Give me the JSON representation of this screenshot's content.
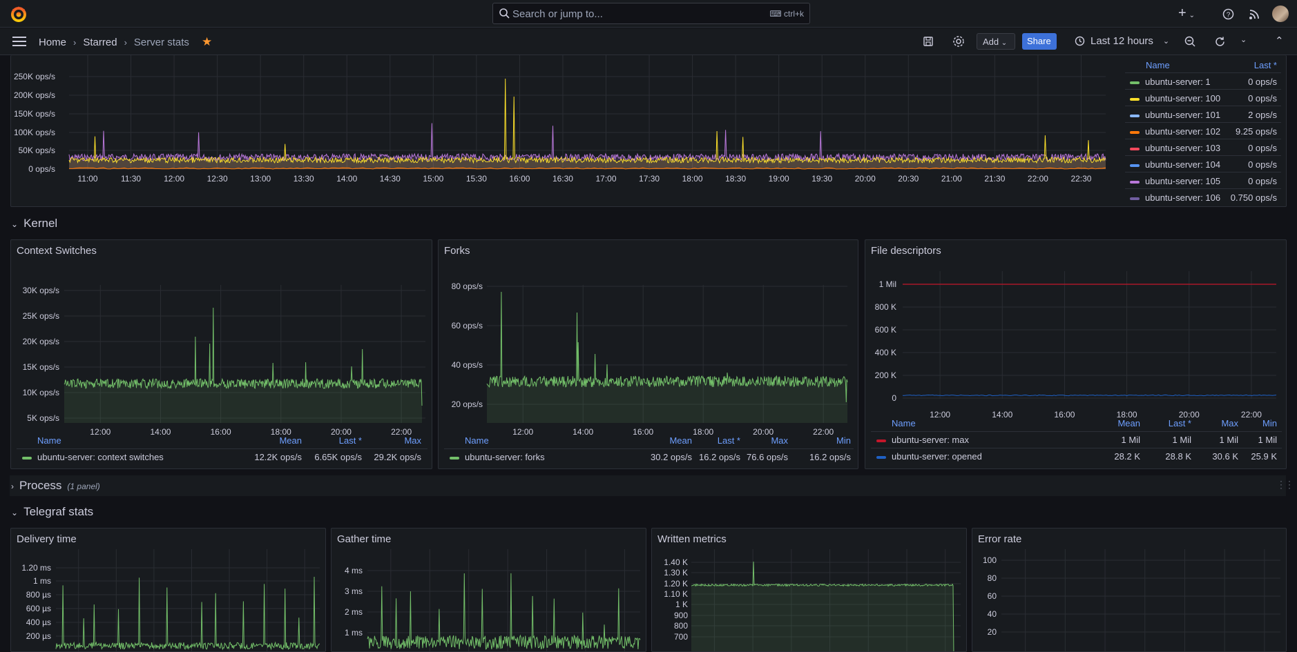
{
  "topbar": {
    "search_placeholder": "Search or jump to...",
    "search_shortcut": "ctrl+k",
    "add_icon": "+",
    "icons": [
      "help-icon",
      "news-icon"
    ]
  },
  "navbar": {
    "breadcrumbs": [
      "Home",
      "Starred",
      "Server stats"
    ],
    "add_label": "Add",
    "share_label": "Share",
    "time_range": "Last 12 hours"
  },
  "top_panel": {
    "y_ticks": [
      "250K ops/s",
      "200K ops/s",
      "150K ops/s",
      "100K ops/s",
      "50K ops/s",
      "0 ops/s"
    ],
    "x_ticks": [
      "11:00",
      "11:30",
      "12:00",
      "12:30",
      "13:00",
      "13:30",
      "14:00",
      "14:30",
      "15:00",
      "15:30",
      "16:00",
      "16:30",
      "17:00",
      "17:30",
      "18:00",
      "18:30",
      "19:00",
      "19:30",
      "20:00",
      "20:30",
      "21:00",
      "21:30",
      "22:00",
      "22:30"
    ],
    "legend_headers": [
      "Name",
      "Last *"
    ],
    "legend": [
      {
        "name": "ubuntu-server: 1",
        "last": "0 ops/s",
        "color": "#73bf69"
      },
      {
        "name": "ubuntu-server: 100",
        "last": "0 ops/s",
        "color": "#fade2a"
      },
      {
        "name": "ubuntu-server: 101",
        "last": "2 ops/s",
        "color": "#8ab8ff"
      },
      {
        "name": "ubuntu-server: 102",
        "last": "9.25 ops/s",
        "color": "#ff780a"
      },
      {
        "name": "ubuntu-server: 103",
        "last": "0 ops/s",
        "color": "#f2495c"
      },
      {
        "name": "ubuntu-server: 104",
        "last": "0 ops/s",
        "color": "#5794f2"
      },
      {
        "name": "ubuntu-server: 105",
        "last": "0 ops/s",
        "color": "#b877d9"
      },
      {
        "name": "ubuntu-server: 106",
        "last": "0.750 ops/s",
        "color": "#705da0"
      }
    ]
  },
  "rows": {
    "kernel": "Kernel",
    "process": "Process",
    "process_sub": "(1 panel)",
    "telegraf": "Telegraf stats"
  },
  "context_switches": {
    "title": "Context Switches",
    "y_ticks": [
      "30K ops/s",
      "25K ops/s",
      "20K ops/s",
      "15K ops/s",
      "10K ops/s",
      "5K ops/s"
    ],
    "x_ticks": [
      "12:00",
      "14:00",
      "16:00",
      "18:00",
      "20:00",
      "22:00"
    ],
    "headers": [
      "Name",
      "Mean",
      "Last *",
      "Max"
    ],
    "row": {
      "name": "ubuntu-server: context switches",
      "mean": "12.2K ops/s",
      "last": "6.65K ops/s",
      "max": "29.2K ops/s",
      "color": "#73bf69"
    }
  },
  "forks": {
    "title": "Forks",
    "y_ticks": [
      "80 ops/s",
      "60 ops/s",
      "40 ops/s",
      "20 ops/s"
    ],
    "x_ticks": [
      "12:00",
      "14:00",
      "16:00",
      "18:00",
      "20:00",
      "22:00"
    ],
    "headers": [
      "Name",
      "Mean",
      "Last *",
      "Max",
      "Min"
    ],
    "row": {
      "name": "ubuntu-server: forks",
      "mean": "30.2 ops/s",
      "last": "16.2 ops/s",
      "max": "76.6 ops/s",
      "min": "16.2 ops/s",
      "color": "#73bf69"
    }
  },
  "file_descriptors": {
    "title": "File descriptors",
    "y_ticks": [
      "1 Mil",
      "800 K",
      "600 K",
      "400 K",
      "200 K",
      "0"
    ],
    "x_ticks": [
      "12:00",
      "14:00",
      "16:00",
      "18:00",
      "20:00",
      "22:00"
    ],
    "headers": [
      "Name",
      "Mean",
      "Last *",
      "Max",
      "Min"
    ],
    "rows": [
      {
        "name": "ubuntu-server: max",
        "mean": "1 Mil",
        "last": "1 Mil",
        "max": "1 Mil",
        "min": "1 Mil",
        "color": "#c4162a"
      },
      {
        "name": "ubuntu-server: opened",
        "mean": "28.2 K",
        "last": "28.8 K",
        "max": "30.6 K",
        "min": "25.9 K",
        "color": "#1f60c4"
      }
    ]
  },
  "delivery_time": {
    "title": "Delivery time",
    "y_ticks": [
      "1.20 ms",
      "1 ms",
      "800 µs",
      "600 µs",
      "400 µs",
      "200 µs"
    ]
  },
  "gather_time": {
    "title": "Gather time",
    "y_ticks": [
      "4 ms",
      "3 ms",
      "2 ms",
      "1 ms"
    ]
  },
  "written_metrics": {
    "title": "Written metrics",
    "y_ticks": [
      "1.40 K",
      "1.30 K",
      "1.20 K",
      "1.10 K",
      "1 K",
      "900",
      "800",
      "700"
    ]
  },
  "error_rate": {
    "title": "Error rate",
    "y_ticks": [
      "100",
      "80",
      "60",
      "40",
      "20"
    ]
  }
}
